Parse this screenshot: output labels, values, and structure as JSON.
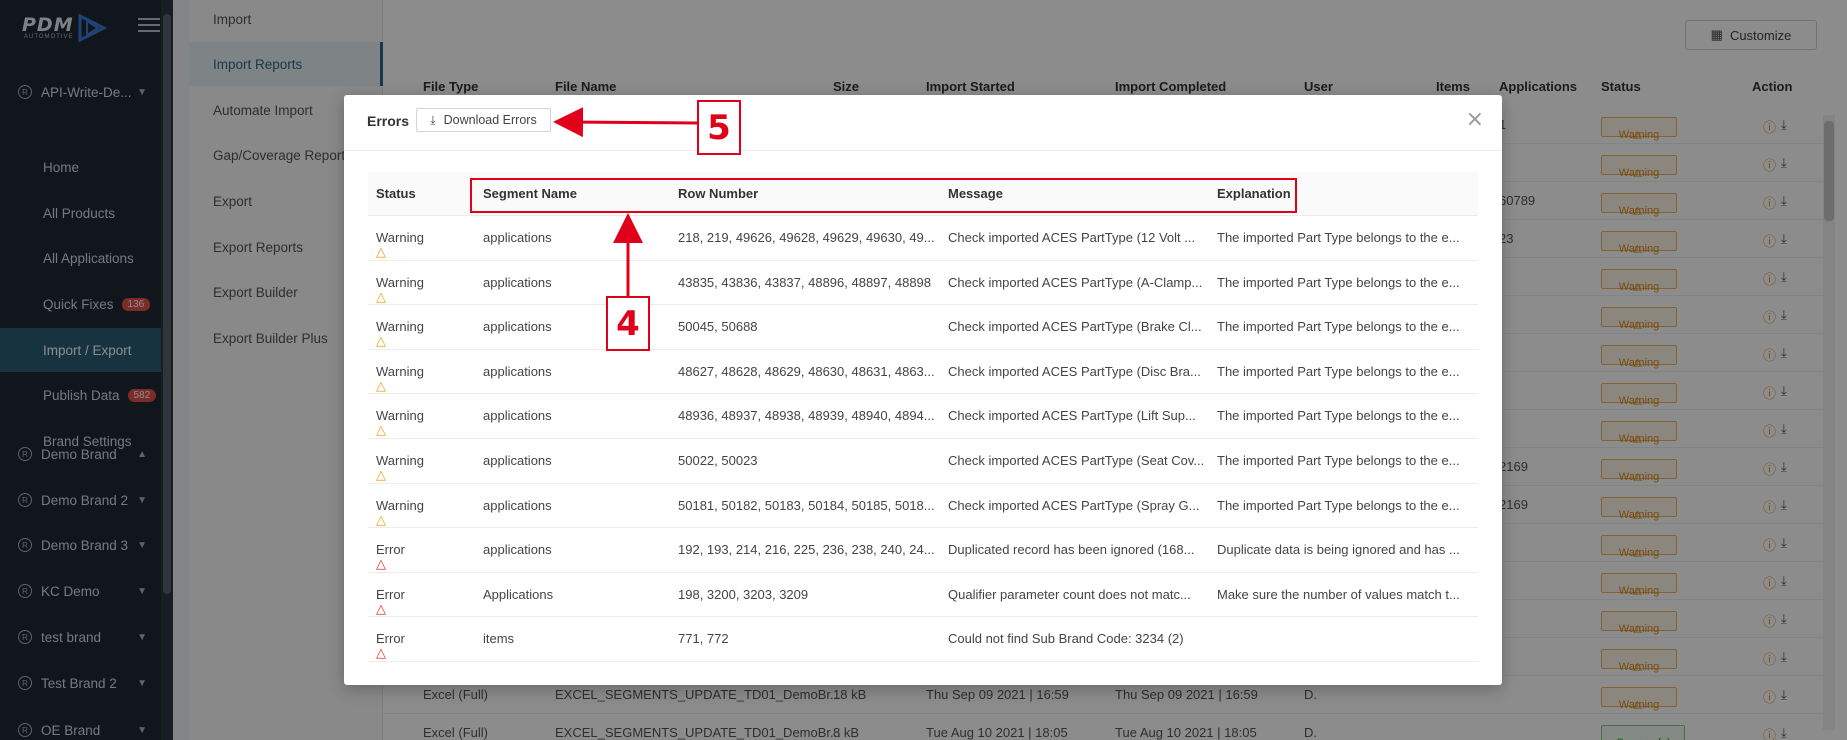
{
  "brand": {
    "logo_text": "PDM",
    "logo_sub": "AUTOMOTIVE"
  },
  "sidebar": {
    "groups": [
      {
        "label": "API-Write-De...",
        "expanded": false
      },
      {
        "label": "Demo Brand",
        "expanded": true
      },
      {
        "label": "Demo Brand 2",
        "expanded": false
      },
      {
        "label": "Demo Brand 3",
        "expanded": false
      },
      {
        "label": "KC Demo",
        "expanded": false
      },
      {
        "label": "test brand",
        "expanded": false
      },
      {
        "label": "Test Brand 2",
        "expanded": false
      },
      {
        "label": "OE Brand",
        "expanded": false
      }
    ],
    "sub_items": [
      {
        "label": "Home"
      },
      {
        "label": "All Products"
      },
      {
        "label": "All Applications"
      },
      {
        "label": "Quick Fixes",
        "badge": "136"
      },
      {
        "label": "Import / Export",
        "active": true
      },
      {
        "label": "Publish Data",
        "badge": "582"
      },
      {
        "label": "Brand Settings"
      }
    ],
    "reg_symbol": "R"
  },
  "subnav": {
    "items": [
      {
        "label": "Import"
      },
      {
        "label": "Import Reports",
        "active": true
      },
      {
        "label": "Automate Import"
      },
      {
        "label": "Gap/Coverage Report"
      },
      {
        "label": "Export"
      },
      {
        "label": "Export Reports"
      },
      {
        "label": "Export Builder"
      },
      {
        "label": "Export Builder Plus"
      }
    ]
  },
  "main": {
    "customize_label": "Customize",
    "columns": [
      "File Type",
      "File Name",
      "Size",
      "Import Started",
      "Import Completed",
      "User",
      "Items",
      "Applications",
      "Status",
      "Action"
    ],
    "partial_apps": [
      "1",
      "",
      "60789",
      "23",
      "",
      "",
      "",
      "",
      "",
      "2169",
      "2169",
      "",
      "",
      "",
      "",
      ""
    ],
    "visible_rows": [
      {
        "file_type": "Excel (Full)",
        "file_name": "EXCEL_SEGMENTS_UPDATE_TD01_DemoBr...",
        "size": "18 kB",
        "started": "Thu Sep 09 2021 | 16:59",
        "completed": "Thu Sep 09 2021 | 16:59",
        "user": "D.",
        "status": "Warning"
      },
      {
        "file_type": "Excel (Full)",
        "file_name": "EXCEL_SEGMENTS_UPDATE_TD01_DemoBr...",
        "size": "8 kB",
        "started": "Tue Aug 10 2021 | 18:05",
        "completed": "Tue Aug 10 2021 | 18:05",
        "user": "D.",
        "status": "Successful"
      }
    ],
    "warning_label": "Warning",
    "successful_label": "Successful"
  },
  "modal": {
    "title": "Errors",
    "download_label": "Download Errors",
    "close_symbol": "×",
    "columns": [
      "Status",
      "Segment Name",
      "Row Number",
      "Message",
      "Explanation"
    ],
    "rows": [
      {
        "status": "Warning",
        "segment": "applications",
        "row_number": "218, 219, 49626, 49628, 49629, 49630, 49...",
        "message": "Check imported ACES PartType (12 Volt ...",
        "explanation": "The imported Part Type belongs to the e..."
      },
      {
        "status": "Warning",
        "segment": "applications",
        "row_number": "43835, 43836, 43837, 48896, 48897, 48898",
        "message": "Check imported ACES PartType (A-Clamp...",
        "explanation": "The imported Part Type belongs to the e..."
      },
      {
        "status": "Warning",
        "segment": "applications",
        "row_number": "50045, 50688",
        "message": "Check imported ACES PartType (Brake Cl...",
        "explanation": "The imported Part Type belongs to the e..."
      },
      {
        "status": "Warning",
        "segment": "applications",
        "row_number": "48627, 48628, 48629, 48630, 48631, 4863...",
        "message": "Check imported ACES PartType (Disc Bra...",
        "explanation": "The imported Part Type belongs to the e..."
      },
      {
        "status": "Warning",
        "segment": "applications",
        "row_number": "48936, 48937, 48938, 48939, 48940, 4894...",
        "message": "Check imported ACES PartType (Lift Sup...",
        "explanation": "The imported Part Type belongs to the e..."
      },
      {
        "status": "Warning",
        "segment": "applications",
        "row_number": "50022, 50023",
        "message": "Check imported ACES PartType (Seat Cov...",
        "explanation": "The imported Part Type belongs to the e..."
      },
      {
        "status": "Warning",
        "segment": "applications",
        "row_number": "50181, 50182, 50183, 50184, 50185, 5018...",
        "message": "Check imported ACES PartType (Spray G...",
        "explanation": "The imported Part Type belongs to the e..."
      },
      {
        "status": "Error",
        "segment": "applications",
        "row_number": "192, 193, 214, 216, 225, 236, 238, 240, 24...",
        "message": "Duplicated record has been ignored (168...",
        "explanation": "Duplicate data is being ignored and has ..."
      },
      {
        "status": "Error",
        "segment": "Applications",
        "row_number": "198, 3200, 3203, 3209",
        "message": "Qualifier parameter count does not matc...",
        "explanation": "Make sure the number of values match t..."
      },
      {
        "status": "Error",
        "segment": "items",
        "row_number": "771, 772",
        "message": "Could not find Sub Brand Code: 3234 (2)",
        "explanation": ""
      }
    ]
  },
  "annotations": {
    "callout_4": "4",
    "callout_5": "5"
  },
  "colors": {
    "sidebar_bg": "#1f2933",
    "active_bg": "#2d5d75",
    "annotation_red": "#e0001a",
    "warning": "#f0a020",
    "error": "#e0302a"
  }
}
